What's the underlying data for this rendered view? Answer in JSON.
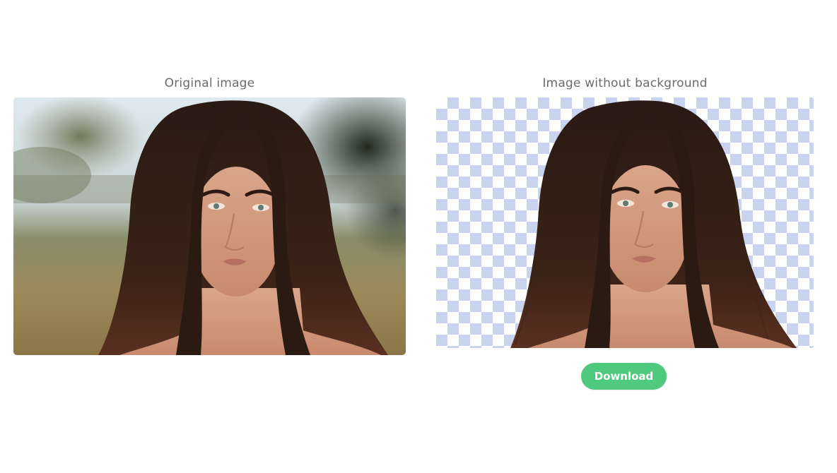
{
  "panels": {
    "original": {
      "title": "Original image"
    },
    "result": {
      "title": "Image without background"
    }
  },
  "actions": {
    "download_label": "Download"
  },
  "colors": {
    "accent": "#4ec97d",
    "checker": "#c9d3ee",
    "title_text": "#6b6b6b"
  }
}
